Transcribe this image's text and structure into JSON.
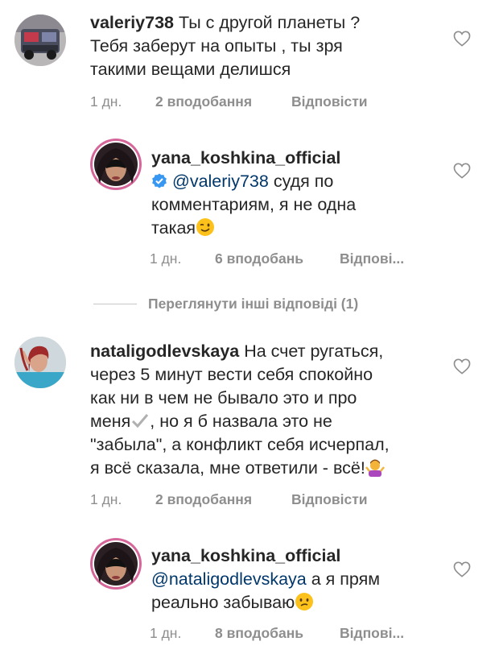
{
  "comments": [
    {
      "username": "valeriy738",
      "mention": "",
      "text_lines": [
        "Ты с другой планеты ?",
        "Тебя заберут на опыты , ты зря",
        "такими вещами делишся"
      ],
      "time": "1 дн.",
      "likes": "2 вподобання",
      "reply": "Відповісти",
      "avatar": "truck-avatar"
    },
    {
      "username": "yana_koshkina_official",
      "verified": true,
      "mention": "@valeriy738",
      "text_lines": [
        "судя по",
        "комментариям, я не одна",
        "такая"
      ],
      "emoji": "winking-face",
      "time": "1 дн.",
      "likes": "6 вподобань",
      "reply": "Відпові...",
      "avatar": "masked-woman-avatar"
    },
    {
      "username": "nataligodlevskaya",
      "mention": "",
      "text_lines": [
        "На счет ругаться,",
        "через 5 минут вести себя спокойно",
        "как ни в чем не бывало это и про",
        "меня",
        ", но я б назвала это не",
        "\"забыла\", а конфликт себя исчерпал,",
        "я всё сказала, мне ответили - всё!"
      ],
      "emoji_check": "check-mark",
      "emoji_shrug": "woman-shrugging",
      "time": "1 дн.",
      "likes": "2 вподобання",
      "reply": "Відповісти",
      "avatar": "woman-avatar"
    },
    {
      "username": "yana_koshkina_official",
      "mention": "@nataligodlevskaya",
      "text_lines": [
        "а я прям",
        "реально забываю"
      ],
      "emoji": "confused-face",
      "time": "1 дн.",
      "likes": "8 вподобань",
      "reply": "Відпові...",
      "avatar": "masked-woman-avatar"
    }
  ],
  "view_more_replies": "Переглянути інші відповіді (1)",
  "colors": {
    "text": "#262626",
    "meta": "#8e8e8e",
    "mention": "#00376b",
    "verified": "#3897f0"
  }
}
